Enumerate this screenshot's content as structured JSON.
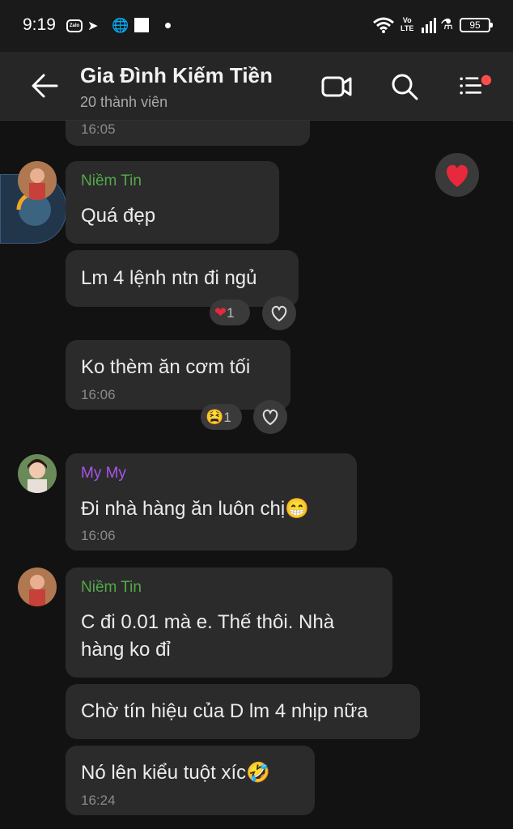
{
  "status_bar": {
    "time": "9:19",
    "network": "Vo\nLTE",
    "battery": "95"
  },
  "header": {
    "title": "Gia Đình Kiếm Tiền",
    "subtitle": "20 thành viên"
  },
  "messages": [
    {
      "time": "16:05"
    },
    {
      "sender": "Niềm Tin",
      "text": "Quá đẹp"
    },
    {
      "text": "Lm 4 lệnh ntn đi ngủ",
      "reaction_count": "1"
    },
    {
      "text": "Ko thèm ăn cơm tối",
      "time": "16:06",
      "reaction_count": "1"
    },
    {
      "sender": "My My",
      "text": "Đi nhà hàng ăn luôn chị😁",
      "time": "16:06"
    },
    {
      "sender": "Niềm Tin",
      "text_line1": "C đi 0.01 mà e. Thế thôi. Nhà",
      "text_line2": "hàng ko đỉ"
    },
    {
      "text": "Chờ tín hiệu của D lm 4 nhịp nữa"
    },
    {
      "text": "Nó lên kiểu tuột xíc🤣",
      "time": "16:24"
    }
  ],
  "colors": {
    "accent_green": "#55a84a",
    "accent_purple": "#a855e8",
    "badge_red": "#ff4d4d"
  },
  "icons": [
    "back-arrow-icon",
    "video-call-icon",
    "search-icon",
    "menu-list-icon",
    "heart-icon",
    "heart-outline-icon"
  ]
}
